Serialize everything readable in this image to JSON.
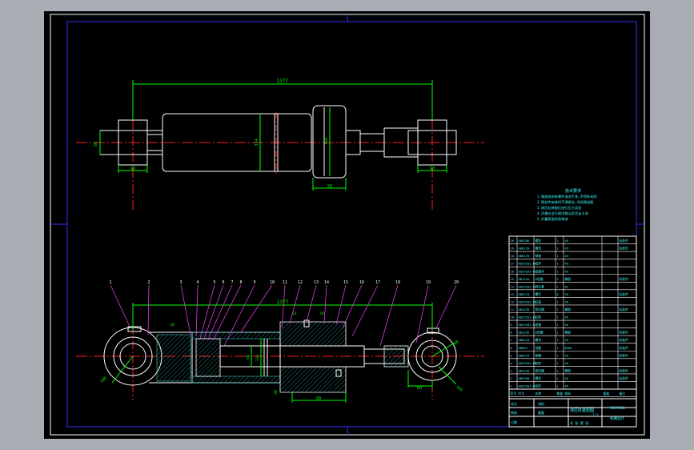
{
  "colors": {
    "background": "#a8acb3",
    "sheet": "#000000",
    "frame_outer": "#ffffff",
    "frame_inner": "#2f2fff",
    "outline": "#ffffff",
    "dimension": "#00ff00",
    "centerline": "#ff2020",
    "leader": "#ff40ff",
    "hatch": "#40c0c0",
    "table": "#ffffff",
    "notes": "#40ffff"
  },
  "top_view": {
    "overall_length": "1377",
    "left_eye_height": "50",
    "left_eye_width": "90",
    "right_eye_width": "90",
    "barrel_diameter": "314",
    "head_diameter": "416",
    "head_width": "50"
  },
  "section_view": {
    "overall_length": "1377",
    "left_eye_radius": "R80",
    "right_eye_radius": "R80",
    "left_eye_hole": "R45",
    "rod_end_width": "60",
    "piston_rod_dia": "60",
    "bore_dia": "314",
    "flange_height": "20",
    "head_width": "50",
    "dim_small_a": "20",
    "dim_small_b": "14",
    "dim_small_c": "70"
  },
  "balloons": [
    "1",
    "2",
    "3",
    "4",
    "5",
    "6",
    "7",
    "8",
    "9",
    "10",
    "11",
    "12",
    "13",
    "14",
    "15",
    "16",
    "17",
    "18",
    "19",
    "20"
  ],
  "parts_table": {
    "rows": [
      [
        "20",
        "GB5780",
        "螺栓",
        "2",
        "45",
        "",
        "标准件"
      ],
      [
        "19",
        "GB6170",
        "螺母",
        "2",
        "45",
        "",
        "标准件"
      ],
      [
        "18",
        "GB6170",
        "销轴",
        "1",
        "45",
        "",
        ""
      ],
      [
        "17",
        "HGSY201-06",
        "耳环",
        "1",
        "45",
        "",
        ""
      ],
      [
        "16",
        "HGSY201-05",
        "活塞杆",
        "1",
        "45",
        "",
        ""
      ],
      [
        "15",
        "GB1235",
        "O形圈",
        "2",
        "橡胶",
        "",
        "标准件"
      ],
      [
        "14",
        "HGSY201-04",
        "导向套",
        "1",
        "QT",
        "",
        ""
      ],
      [
        "13",
        "GB6170",
        "螺钉",
        "6",
        "35",
        "",
        "标准件"
      ],
      [
        "12",
        "HGSY201-03",
        "缸盖",
        "1",
        "45",
        "",
        ""
      ],
      [
        "11",
        "GB1235",
        "密封圈",
        "1",
        "橡胶",
        "",
        "标准件"
      ],
      [
        "10",
        "HGSY201-02",
        "缸筒",
        "1",
        "45",
        "",
        ""
      ],
      [
        "9",
        "HGSY201-01",
        "活塞",
        "1",
        "45",
        "",
        ""
      ],
      [
        "8",
        "GB1235",
        "O形圈",
        "1",
        "橡胶",
        "",
        "标准件"
      ],
      [
        "7",
        "GB6170",
        "螺母",
        "1",
        "45",
        "",
        "标准件"
      ],
      [
        "6",
        "GB894",
        "挡圈",
        "1",
        "65Mn",
        "",
        "标准件"
      ],
      [
        "5",
        "GB6170",
        "垫圈",
        "1",
        "45",
        "",
        "标准件"
      ],
      [
        "4",
        "HGSY201-00",
        "缸底",
        "1",
        "45",
        "",
        ""
      ],
      [
        "3",
        "GB1235",
        "密封圈",
        "2",
        "橡胶",
        "",
        "标准件"
      ],
      [
        "2",
        "GB5780",
        "螺栓",
        "2",
        "45",
        "",
        "标准件"
      ],
      [
        "1",
        "HGSY201-07",
        "耳环",
        "1",
        "45",
        "",
        ""
      ]
    ],
    "header": [
      "序号",
      "代号",
      "名称",
      "数量",
      "材料",
      "重量",
      "备注"
    ]
  },
  "title_block": {
    "drawing_name": "液压缸装配图",
    "scale": "1:5",
    "sheet": "共 张 第 张",
    "drawing_no": "HGSY201",
    "school": "机械设计",
    "designer": "设计",
    "checker": "审核",
    "date": "日期",
    "material": "材料",
    "weight": "重量"
  },
  "technical_notes": {
    "heading": "技术要求",
    "lines": [
      "1.装配前所有零件清洗干净,不得有毛刺",
      "2.密封件安装时不得损伤,涂润滑油脂",
      "3.液压缸装配后进行压力试验",
      "4.活塞在全行程内移动灵活无卡滞",
      "5.外露表面涂防锈漆"
    ]
  }
}
